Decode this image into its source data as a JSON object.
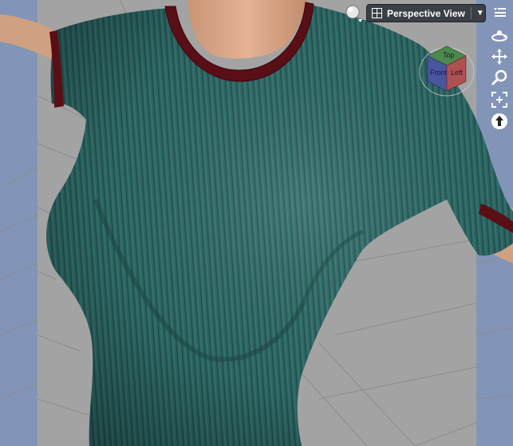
{
  "viewport": {
    "camera_label": "Perspective View",
    "camera_dropdown_arrow": "▼",
    "colors": {
      "background": "#8295b8",
      "floor": "#a3a3a3",
      "shirt": "#2f6b68",
      "collar": "#5a0f16",
      "skin": "#d9a98a"
    }
  },
  "view_cube": {
    "faces": {
      "top": "Top",
      "front": "Front",
      "left": "Left"
    }
  },
  "side_controls": [
    {
      "name": "orbit",
      "icon": "orbit-icon"
    },
    {
      "name": "pan",
      "icon": "pan-move-icon"
    },
    {
      "name": "zoom",
      "icon": "zoom-icon"
    },
    {
      "name": "frame",
      "icon": "frame-icon"
    },
    {
      "name": "aim",
      "icon": "aim-up-icon"
    }
  ]
}
